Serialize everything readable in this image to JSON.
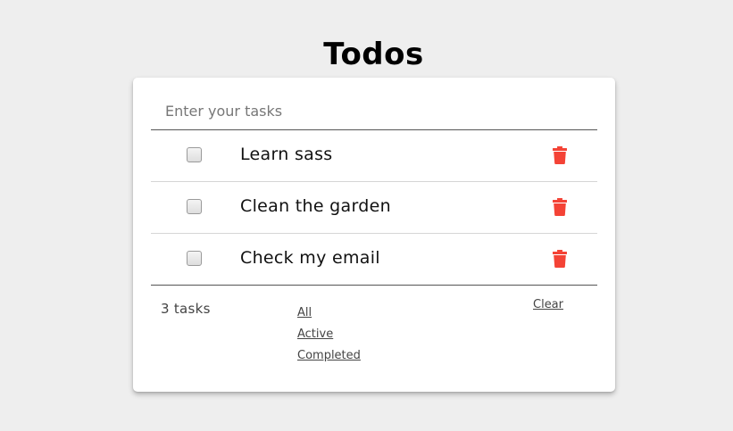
{
  "app": {
    "title": "Todos"
  },
  "input": {
    "placeholder": "Enter your tasks",
    "value": ""
  },
  "tasks": [
    {
      "label": "Learn sass",
      "completed": false
    },
    {
      "label": "Clean the garden",
      "completed": false
    },
    {
      "label": "Check my email",
      "completed": false
    }
  ],
  "footer": {
    "count_number": "3",
    "count_word": "tasks",
    "filters": [
      "All",
      "Active",
      "Completed"
    ],
    "clear_label": "Clear"
  },
  "icons": {
    "delete": "trash-icon"
  },
  "colors": {
    "background": "#eeeeee",
    "card": "#ffffff",
    "delete": "#f44336",
    "text": "#111111"
  }
}
